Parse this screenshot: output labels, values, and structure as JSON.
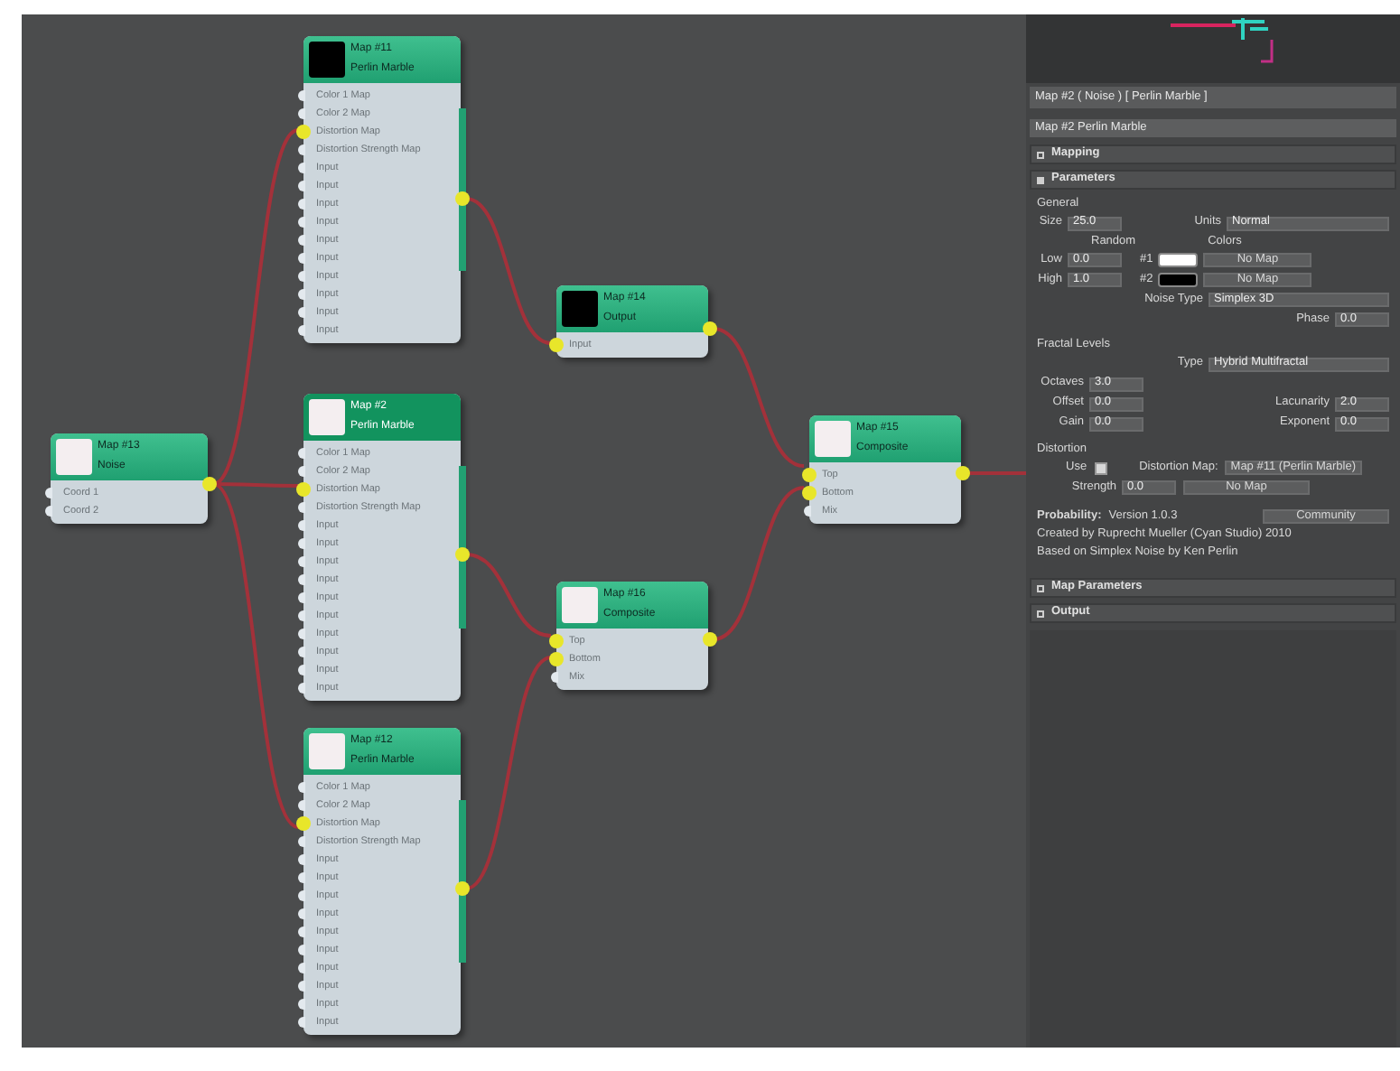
{
  "nodes": [
    {
      "title": "Map #13",
      "subtitle": "Noise",
      "color": "#f4eef0",
      "ports": [
        {
          "label": "Coord 1",
          "connected": false
        },
        {
          "label": "Coord 2",
          "connected": false
        }
      ]
    },
    {
      "title": "Map #11",
      "subtitle": "Perlin Marble",
      "color": "#000000",
      "ports": [
        {
          "label": "Color 1 Map",
          "connected": false
        },
        {
          "label": "Color 2 Map",
          "connected": false
        },
        {
          "label": "Distortion Map",
          "connected": true
        },
        {
          "label": "Distortion Strength Map",
          "connected": false
        },
        {
          "label": "Input",
          "connected": false
        },
        {
          "label": "Input",
          "connected": false
        },
        {
          "label": "Input",
          "connected": false
        },
        {
          "label": "Input",
          "connected": false
        },
        {
          "label": "Input",
          "connected": false
        },
        {
          "label": "Input",
          "connected": false
        },
        {
          "label": "Input",
          "connected": false
        },
        {
          "label": "Input",
          "connected": false
        },
        {
          "label": "Input",
          "connected": false
        },
        {
          "label": "Input",
          "connected": false
        }
      ]
    },
    {
      "title": "Map #2",
      "subtitle": "Perlin Marble",
      "color": "#f4eef0",
      "selected": true,
      "ports": [
        {
          "label": "Color 1 Map",
          "connected": false
        },
        {
          "label": "Color 2 Map",
          "connected": false
        },
        {
          "label": "Distortion Map",
          "connected": true
        },
        {
          "label": "Distortion Strength Map",
          "connected": false
        },
        {
          "label": "Input",
          "connected": false
        },
        {
          "label": "Input",
          "connected": false
        },
        {
          "label": "Input",
          "connected": false
        },
        {
          "label": "Input",
          "connected": false
        },
        {
          "label": "Input",
          "connected": false
        },
        {
          "label": "Input",
          "connected": false
        },
        {
          "label": "Input",
          "connected": false
        },
        {
          "label": "Input",
          "connected": false
        },
        {
          "label": "Input",
          "connected": false
        },
        {
          "label": "Input",
          "connected": false
        }
      ]
    },
    {
      "title": "Map #12",
      "subtitle": "Perlin Marble",
      "color": "#f4eef0",
      "ports": [
        {
          "label": "Color 1 Map",
          "connected": false
        },
        {
          "label": "Color 2 Map",
          "connected": false
        },
        {
          "label": "Distortion Map",
          "connected": true
        },
        {
          "label": "Distortion Strength Map",
          "connected": false
        },
        {
          "label": "Input",
          "connected": false
        },
        {
          "label": "Input",
          "connected": false
        },
        {
          "label": "Input",
          "connected": false
        },
        {
          "label": "Input",
          "connected": false
        },
        {
          "label": "Input",
          "connected": false
        },
        {
          "label": "Input",
          "connected": false
        },
        {
          "label": "Input",
          "connected": false
        },
        {
          "label": "Input",
          "connected": false
        },
        {
          "label": "Input",
          "connected": false
        },
        {
          "label": "Input",
          "connected": false
        }
      ]
    },
    {
      "title": "Map #14",
      "subtitle": "Output",
      "color": "#000000",
      "ports": [
        {
          "label": "Input",
          "connected": true
        }
      ]
    },
    {
      "title": "Map #15",
      "subtitle": "Composite",
      "color": "#f4eef0",
      "ports": [
        {
          "label": "Top",
          "connected": true
        },
        {
          "label": "Bottom",
          "connected": true
        },
        {
          "label": "Mix",
          "connected": false
        }
      ]
    },
    {
      "title": "Map #16",
      "subtitle": "Composite",
      "color": "#f4eef0",
      "ports": [
        {
          "label": "Top",
          "connected": true
        },
        {
          "label": "Bottom",
          "connected": true
        },
        {
          "label": "Mix",
          "connected": false
        }
      ]
    }
  ],
  "panel": {
    "tab_title": "Map #2 ( Noise ) [ Perlin Marble ]",
    "map_name": "Map #2 Perlin Marble",
    "rollouts_top": [
      {
        "label": "Mapping",
        "expanded": false
      },
      {
        "label": "Parameters",
        "expanded": true
      }
    ],
    "general": {
      "heading": "General",
      "size": {
        "label": "Size",
        "value": "25.0"
      },
      "units": {
        "label": "Units",
        "value": "Normal"
      },
      "random_label": "Random",
      "colors_label": "Colors",
      "low": {
        "label": "Low",
        "value": "0.0"
      },
      "high": {
        "label": "High",
        "value": "1.0"
      },
      "colors": [
        {
          "label": "#1",
          "color": "#ffffff",
          "map": "No Map"
        },
        {
          "label": "#2",
          "color": "#000000",
          "map": "No Map"
        }
      ],
      "noise_type": {
        "label": "Noise Type",
        "value": "Simplex 3D"
      },
      "phase": {
        "label": "Phase",
        "value": "0.0"
      }
    },
    "fractal": {
      "heading": "Fractal Levels",
      "type": {
        "label": "Type",
        "value": "Hybrid Multifractal"
      },
      "left": [
        {
          "label": "Octaves",
          "value": "3.0"
        },
        {
          "label": "Offset",
          "value": "0.0"
        },
        {
          "label": "Gain",
          "value": "0.0"
        }
      ],
      "right": [
        {
          "label": "Lacunarity",
          "value": "2.0"
        },
        {
          "label": "Exponent",
          "value": "0.0"
        }
      ]
    },
    "distortion": {
      "heading": "Distortion",
      "use_label": "Use",
      "use_checked": true,
      "map_label": "Distortion Map:",
      "map_button": "Map #11 (Perlin Marble)",
      "strength": {
        "label": "Strength",
        "value": "0.0"
      },
      "strength_map": "No Map"
    },
    "about": {
      "label": "Probability:",
      "version": "Version 1.0.3",
      "button": "Community"
    },
    "credits": [
      "Created by Ruprecht Mueller (Cyan Studio) 2010",
      "Based on Simplex Noise by Ken Perlin"
    ],
    "rollouts_bottom": [
      {
        "label": "Map Parameters",
        "expanded": false
      },
      {
        "label": "Output",
        "expanded": false
      }
    ]
  }
}
